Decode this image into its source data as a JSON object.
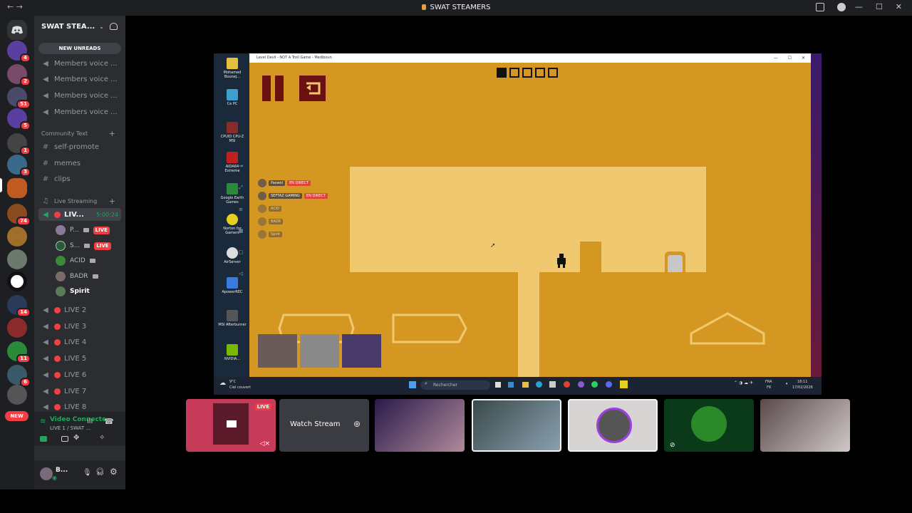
{
  "window": {
    "title": "SWAT STEAMERS"
  },
  "guild": {
    "name": "SWAT STEA...",
    "new_unreads": "NEW UNREADS"
  },
  "servers": {
    "badges": [
      "4",
      "2",
      "51",
      "5",
      "1",
      "3",
      "74",
      "14",
      "11",
      "6"
    ],
    "new_badge": "NEW"
  },
  "channels": {
    "members_voice": [
      "Members voice ...",
      "Members voice ...",
      "Members voice ...",
      "Members voice ..."
    ],
    "community_text_category": "Community Text",
    "text_channels": [
      "self-promote",
      "memes",
      "clips"
    ],
    "live_category": "Live Streaming",
    "active_channel": {
      "name": "LIV...",
      "timer": "5:00:24"
    },
    "voice_users": [
      {
        "name": "P...",
        "live": "LIVE"
      },
      {
        "name": "S...",
        "live": "LIVE"
      },
      {
        "name": "ACID"
      },
      {
        "name": "BADR"
      },
      {
        "name": "Spirit"
      }
    ],
    "live_channels": [
      "LIVE 2",
      "LIVE 3",
      "LIVE 4",
      "LIVE 5",
      "LIVE 6",
      "LIVE 7",
      "LIVE 8"
    ]
  },
  "voice_panel": {
    "status": "Video Connecte...",
    "channel": "LIVE 1 / SWAT ..."
  },
  "user_panel": {
    "name": "B..."
  },
  "screenshare": {
    "app_title": "Level Devil - NOT A Troll Game - Mediboun",
    "desktop_icons": [
      "Mohamed Bounej...",
      "Ce PC",
      "CPUID CPU-Z MSI",
      "AIDA64 Extreme",
      "Google Earth Games",
      "Norton for Gamers",
      "AirServer",
      "ApowerREC",
      "MSI Afterburner",
      "NVIDIA..."
    ],
    "overlay_users": [
      {
        "name": "Paswol",
        "tag": "EN DIRECT"
      },
      {
        "name": "SEFTAZ GAMING",
        "tag": "EN DIRECT"
      },
      {
        "name": "ACID"
      },
      {
        "name": "BADR"
      },
      {
        "name": "Spirit"
      }
    ],
    "level_boxes": 5,
    "level_filled": 1,
    "taskbar": {
      "weather_temp": "9°C",
      "weather_desc": "Ciel couvert",
      "search_placeholder": "Rechercher",
      "lang": "FRA",
      "region": "FR",
      "time": "18:11",
      "date": "17/02/2026"
    }
  },
  "tiles": {
    "live_tag": "LIVE",
    "watch_stream": "Watch Stream"
  },
  "colors": {
    "game_bg": "#d49722",
    "game_platform": "#f0c870",
    "game_dark": "#6b1010",
    "discord_red": "#f23f43",
    "discord_bg": "#2b2d31"
  }
}
